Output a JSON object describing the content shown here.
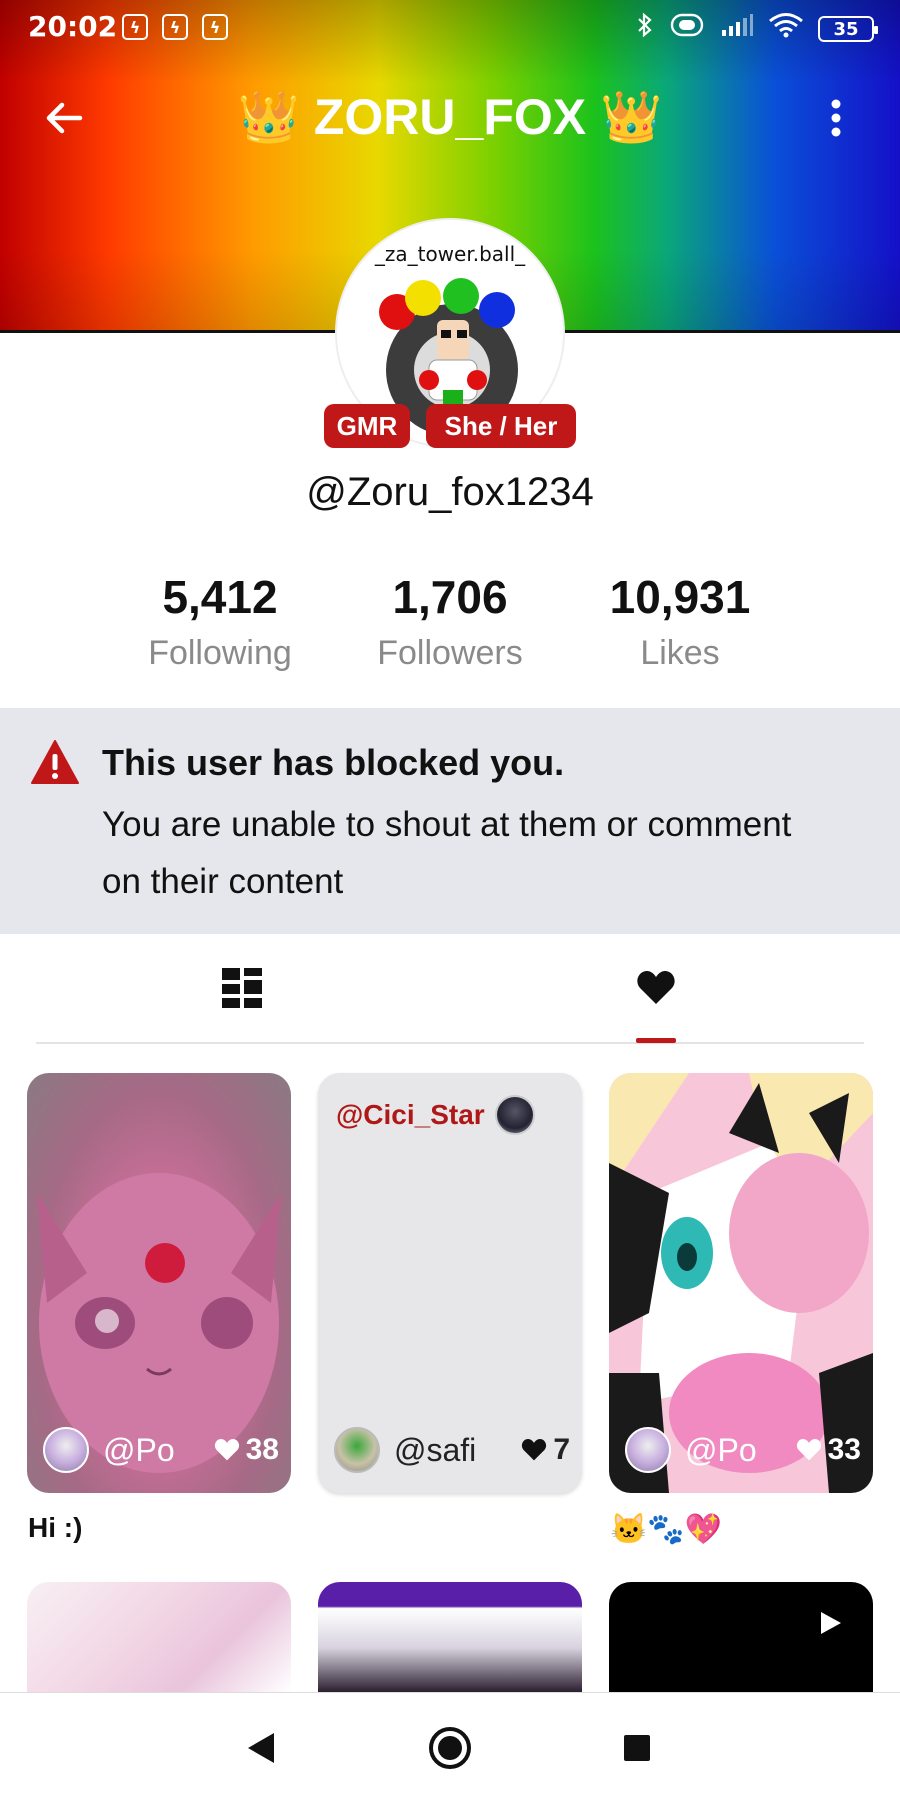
{
  "status_bar": {
    "time": "20:02",
    "battery": "35",
    "notification_icons": [
      "lightning-icon",
      "lightning-icon",
      "lightning-icon"
    ]
  },
  "header": {
    "title": "ZORU_FOX",
    "title_emoji": "👑",
    "gradient_colors": [
      "#c00000",
      "#ff9a00",
      "#e8d800",
      "#1cc21c",
      "#0a50d8",
      "#1410c8"
    ]
  },
  "profile": {
    "avatar_caption": "_za_tower.ball_",
    "badges": [
      "GMR",
      "She / Her"
    ],
    "username": "@Zoru_fox1234"
  },
  "stats": [
    {
      "value": "5,412",
      "label": "Following"
    },
    {
      "value": "1,706",
      "label": "Followers"
    },
    {
      "value": "10,931",
      "label": "Likes"
    }
  ],
  "blocked_notice": {
    "title": "This user has blocked you.",
    "description": "You are unable to shout at them or comment on their content"
  },
  "tabs": [
    {
      "icon": "grid-icon",
      "active": false
    },
    {
      "icon": "heart-icon",
      "active": true
    }
  ],
  "posts": [
    {
      "user": "@Po",
      "likes": "38",
      "caption": "Hi :)"
    },
    {
      "shoutout": "@Cici_Star",
      "user": "@safi",
      "likes": "7",
      "caption": ""
    },
    {
      "user": "@Po",
      "likes": "33",
      "caption": "🐱🐾💖"
    }
  ],
  "colors": {
    "accent": "#c01818",
    "banner_bg": "#e6e7ec",
    "stat_label": "#8a8a8a"
  }
}
